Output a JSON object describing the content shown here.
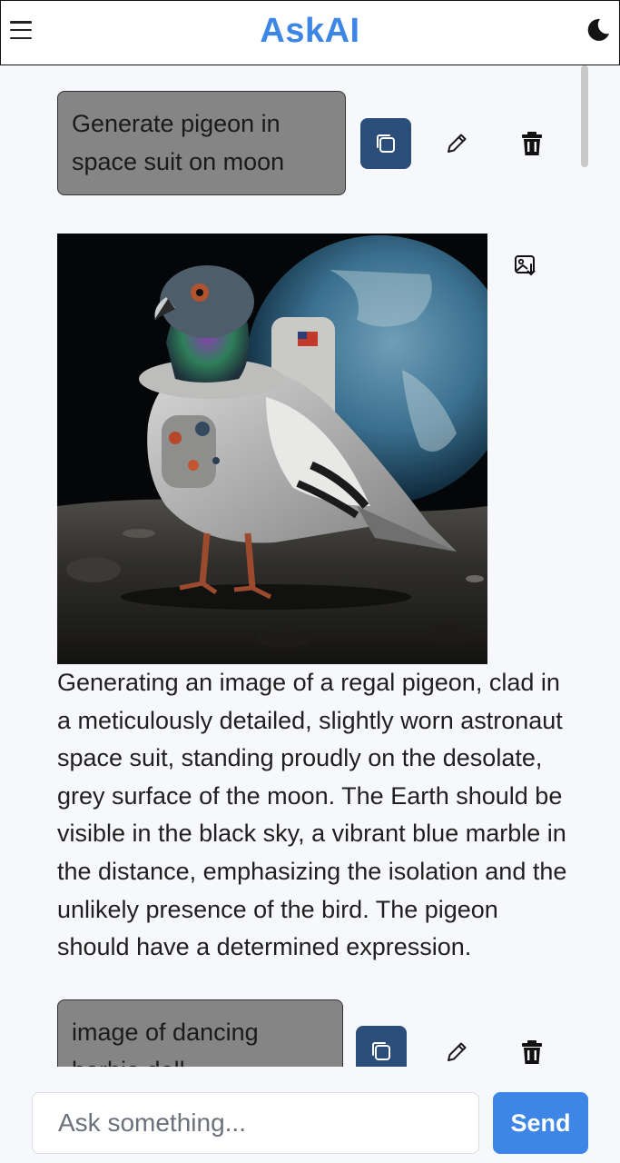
{
  "header": {
    "title": "AskAI",
    "menu_icon": "hamburger-menu-icon",
    "theme_icon": "moon-icon"
  },
  "messages": [
    {
      "prompt": "Generate pigeon in space suit on moon",
      "actions": [
        "copy-icon",
        "pencil-icon",
        "trash-icon"
      ],
      "response_text": "Generating an image of a regal pigeon, clad in a meticulously detailed, slightly worn astronaut space suit, standing proudly on the desolate, grey surface of the moon. The Earth should be visible in the black sky, a vibrant blue marble in the distance, emphasizing the isolation and the unlikely presence of the bird. The pigeon should have a determined expression.",
      "image_action_icon": "image-download-icon"
    },
    {
      "prompt": "image of dancing barbie doll",
      "actions": [
        "copy-icon",
        "pencil-icon",
        "trash-icon"
      ]
    }
  ],
  "composer": {
    "placeholder": "Ask something...",
    "send_label": "Send"
  },
  "colors": {
    "accent": "#3d86e6",
    "copy_button": "#2a4d7a",
    "prompt_bubble": "#858585",
    "background": "#f7f8fb"
  }
}
